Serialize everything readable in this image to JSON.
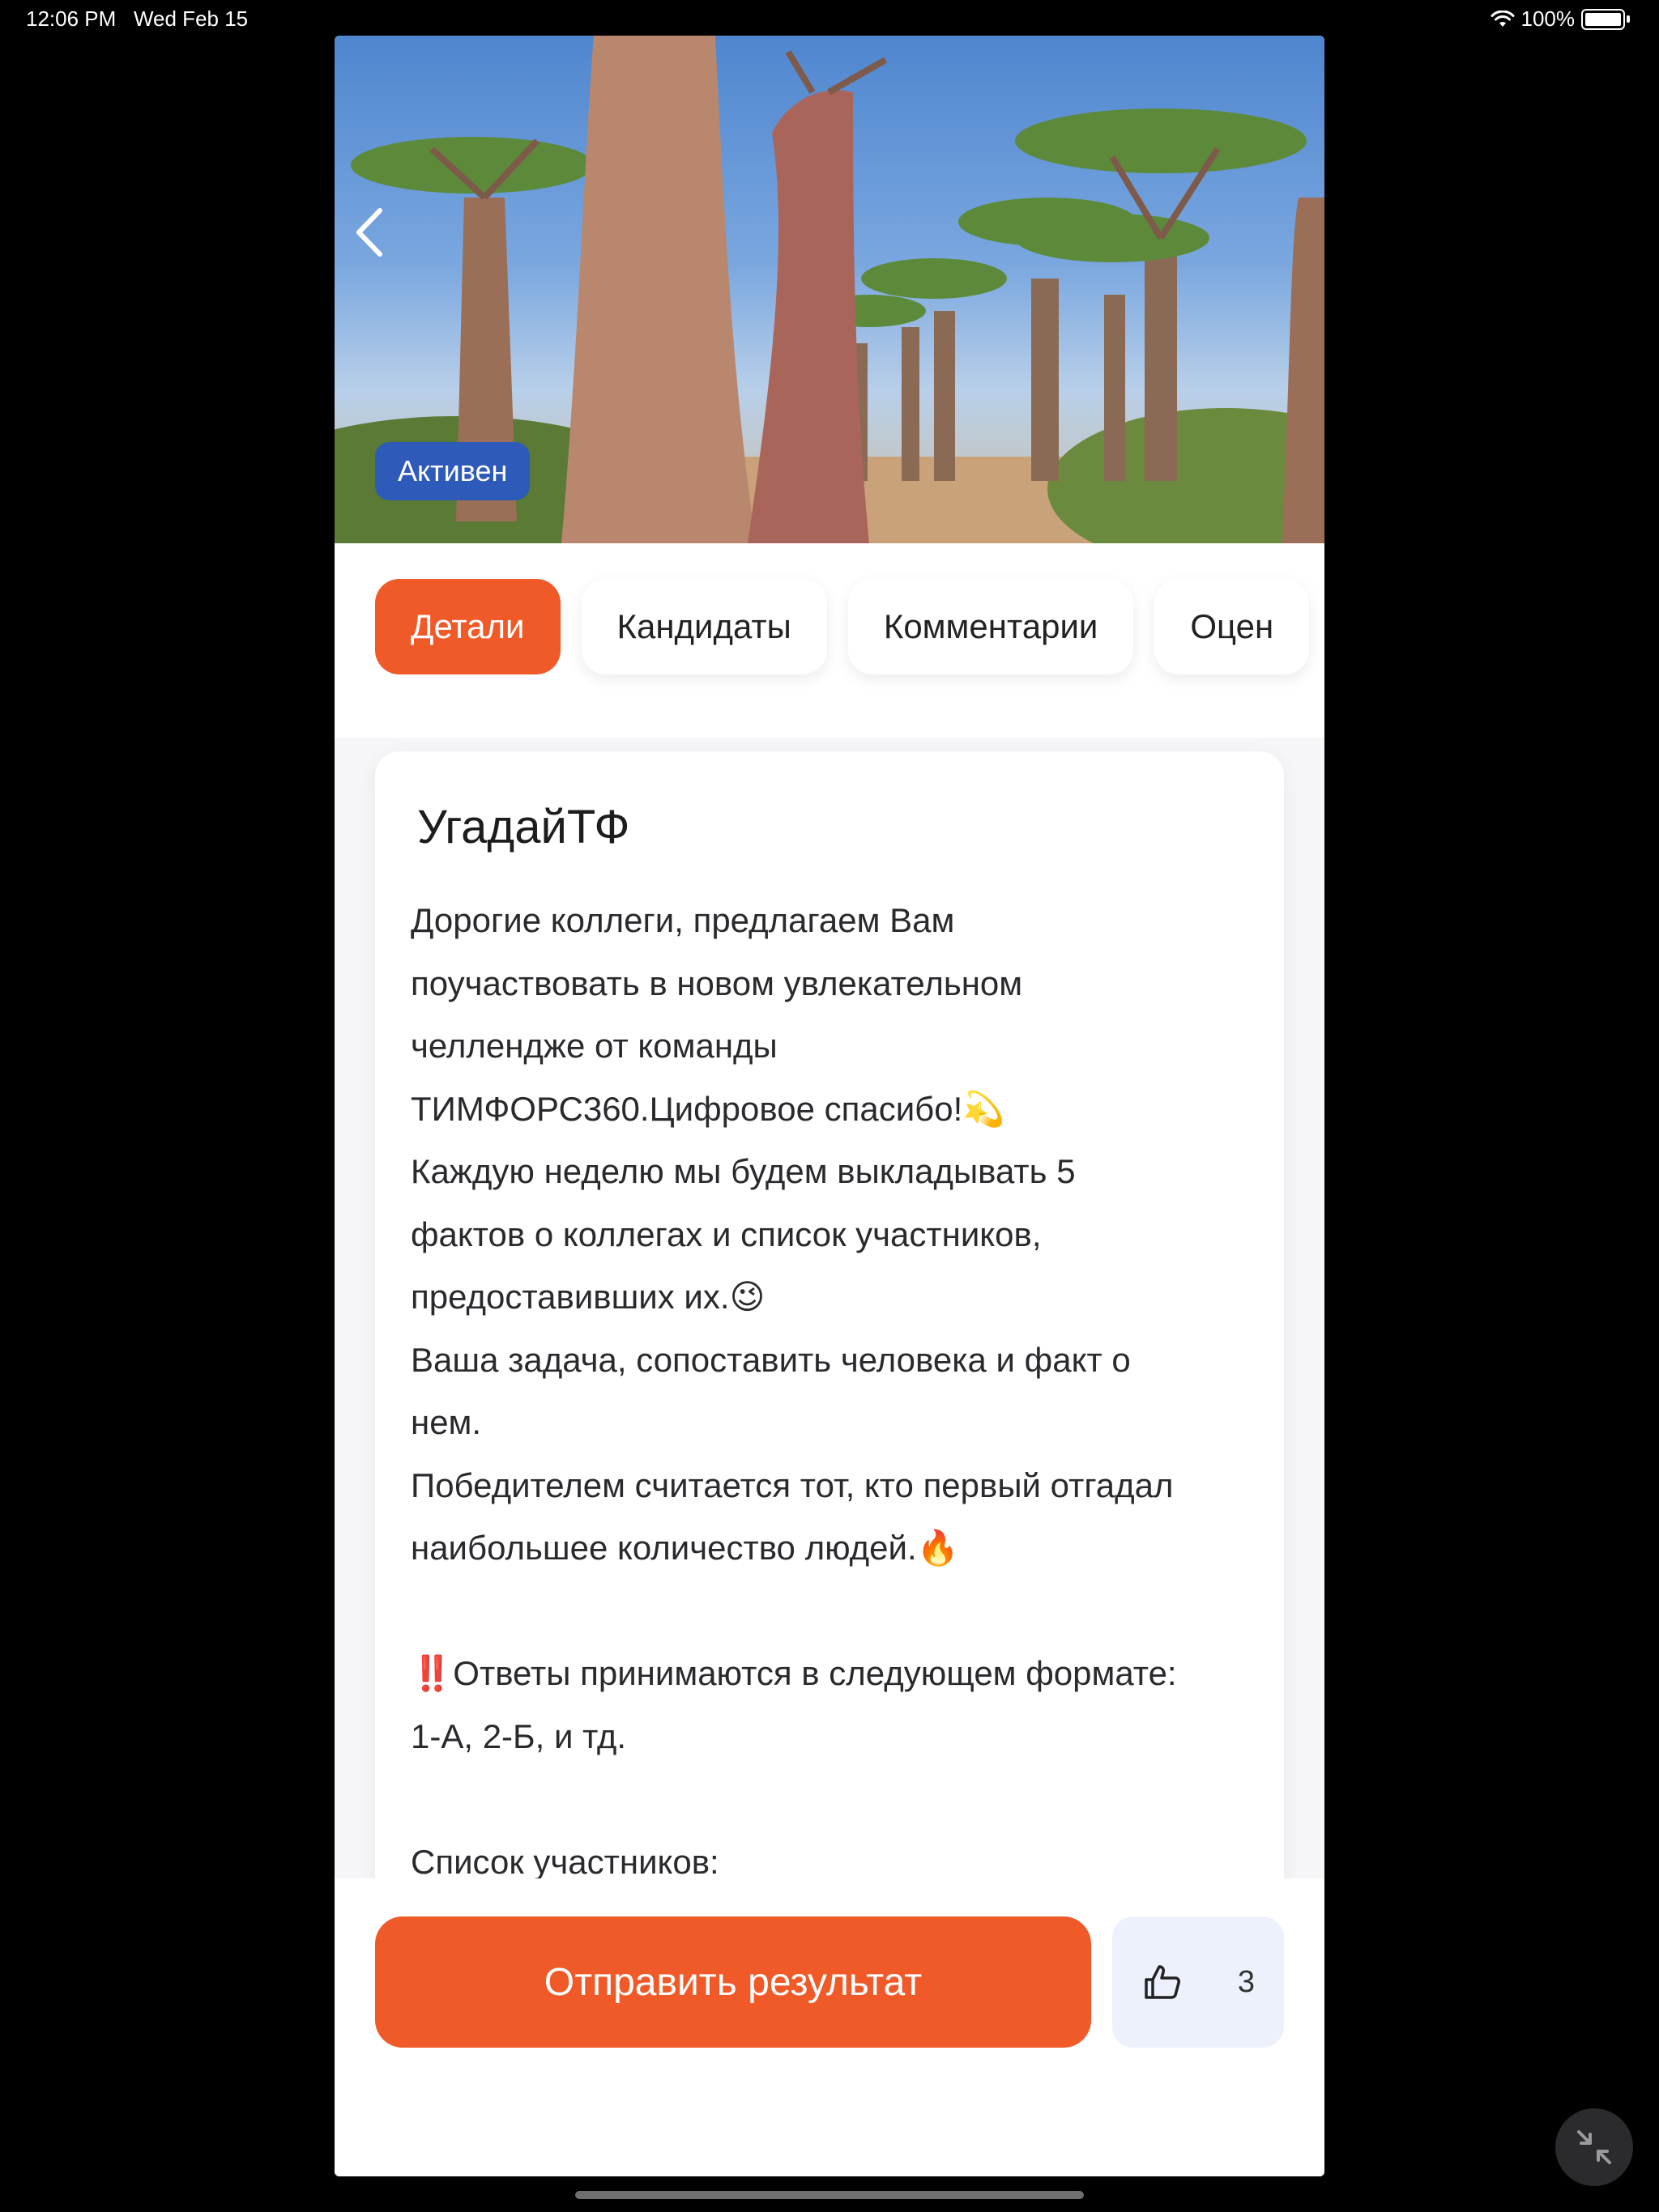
{
  "status_bar": {
    "time": "12:06 PM",
    "date": "Wed Feb 15",
    "battery": "100%"
  },
  "hero": {
    "status_badge": "Активен"
  },
  "tabs": [
    {
      "label": "Детали",
      "active": true
    },
    {
      "label": "Кандидаты",
      "active": false
    },
    {
      "label": "Комментарии",
      "active": false
    },
    {
      "label": "Оцен",
      "active": false
    }
  ],
  "card": {
    "title": "УгадайТФ",
    "paragraphs": [
      "Дорогие коллеги, предлагаем Вам",
      "поучаствовать в новом увлекательном",
      "челлендже от команды",
      "ТИМФОРС360.Цифровое спасибо!💫",
      "Каждую неделю мы будем выкладывать 5",
      "фактов о коллегах и список участников,",
      "предоставивших их.😉",
      "Ваша задача, сопоставить человека и факт о",
      "нем.",
      "Победителем считается тот, кто первый отгадал",
      "наибольшее количество людей.🔥",
      "",
      "‼️Ответы принимаются в следующем формате:",
      "1-А, 2-Б, и тд.",
      "",
      "Список участников:"
    ]
  },
  "actions": {
    "submit_label": "Отправить результат",
    "like_count": "3"
  },
  "colors": {
    "accent": "#f05a28",
    "badge": "#2e5ab9",
    "like_bg": "#edf1fb"
  }
}
